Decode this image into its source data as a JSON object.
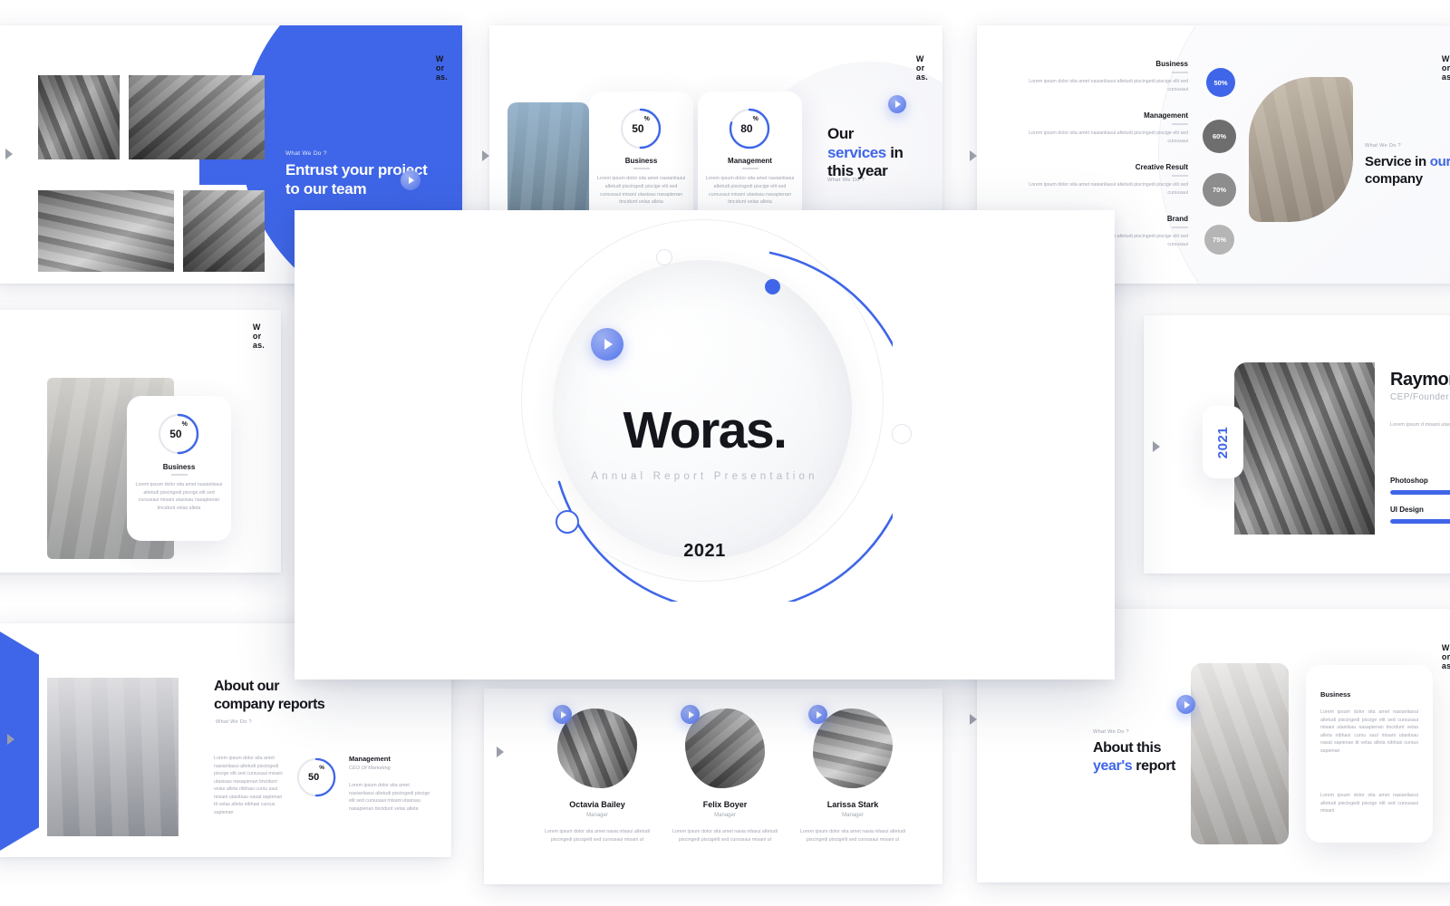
{
  "brand": {
    "logo_lines": [
      "W",
      "or",
      "as."
    ],
    "accent_color": "#3f66e8",
    "accent_color_light": "#7f97ef",
    "dark_color": "#14161c",
    "muted_color": "#a2a7b2"
  },
  "lorem": {
    "short": "Lorem ipsum dolor sita amet nasianliasui altetudi piscingedi piscige elit sed cursusaui misani utasisau nasapienan tincidunt velas alleta",
    "two_line": "Lorem ipsum dolor sita amet nasianliasui altetudi piscingedi piscige elit sed cursusaui",
    "team": "Lorem ipsum dolor sita amet nasia nilasui altetudi piscingedi piscigelit sed cursusaui misani ut",
    "long": "Lorem ipsum dolor sita amet nasianliasui altetudi piscingedi piscige elit sed cursusaui misani utasilsau nasapienan tincidunt velas alleta nibhasi cursu saul misani utasitsau nasat sapienan tit velas alleta nibhasi cursus sapienan",
    "medium": "Lorem ipsum dolor sita amet nasianliasui altetudi piscingedi piscige elit sed cursusaui misani",
    "col_left": "Lorem ipsum dolor sita amet nasianliasui altetudi piscingedi piscige elit sed cursusaui misani utasisau nasapienan tincidunt velas alleta nibhasi cursu saul misani utasitsau nasat sapienan tit velas alleta nibhasi cursus sapienan",
    "bio": "Lorem ipsum d misani utasitsau nasat sapienan utasitsau nasapi"
  },
  "slides": {
    "entrust": {
      "eyebrow": "What We Do ?",
      "title": "Entrust your project to our team",
      "nav_label": "next-slide"
    },
    "services": {
      "title_line1": "Our",
      "title_accent": "services",
      "title_line1_tail": "in",
      "title_line2": "this year",
      "eyebrow": "What We Do ?",
      "cards": [
        {
          "percent": "50",
          "symbol": "%",
          "label": "Business",
          "value": 50,
          "body": "Lorem ipsum dolor sita amet nasianliasui altetudi piscingedi piscige elit sed cursusaui misani utasisau nasapienan tincidunt velas alleta"
        },
        {
          "percent": "80",
          "symbol": "%",
          "label": "Management",
          "value": 80,
          "body": "Lorem ipsum dolor sita amet nasianliasui altetudi piscingedi piscige elit sed cursusaui misani utasisau nasapienan tincidunt velas alleta"
        }
      ]
    },
    "service_company": {
      "eyebrow": "What We Do ?",
      "title_lead": "Service in",
      "title_accent": "our",
      "title_line2": "company",
      "items": [
        {
          "label": "Business",
          "percent": "50%",
          "body": "Lorem ipsum dolor sita amet nasianliasui altetudi piscingedi piscige elit sed cursusaui",
          "color": "#3f66e8"
        },
        {
          "label": "Management",
          "percent": "60%",
          "body": "Lorem ipsum dolor sita amet nasianliasui altetudi piscingedi piscige elit sed cursusaui",
          "color": "#6e6e6e"
        },
        {
          "label": "Creative Result",
          "percent": "70%",
          "body": "Lorem ipsum dolor sita amet nasianliasui altetudi piscingedi piscige elit sed cursusaui",
          "color": "#8d8d8d"
        },
        {
          "label": "Brand",
          "percent": "75%",
          "body": "Lorem ipsum dolor sita amet nasianliasui altetudi piscingedi piscige elit sed cursusaui",
          "color": "#b5b5b5"
        }
      ]
    },
    "business_card": {
      "percent": "50",
      "symbol": "%",
      "value": 50,
      "label": "Business",
      "body": "Lorem ipsum dolor sita amet nasianliasui altetudi piscingedi piscige elit sed cursusaui misani utasisau nasapienan tincidunt velas alleta"
    },
    "profile": {
      "name": "Raymond",
      "role": "CEP/Founder",
      "badge_year": "2021",
      "bio": "Lorem ipsum d misani utasitsau nasat sapienan utasitsau nasapi",
      "skills": [
        {
          "label": "Photoshop",
          "value": 85
        },
        {
          "label": "UI Design",
          "value": 90
        }
      ]
    },
    "hero": {
      "title": "Woras.",
      "subtitle": "Annual Report Presentation",
      "year": "2021"
    },
    "about_reports": {
      "title_line1": "About our",
      "title_line2": "company reports",
      "eyebrow": "What We Do ?",
      "left_body": "Lorem ipsum dolor sita amet nasianliasui altetudi piscingedi piscige elit sed cursusaui misani utasisau nasapienan tincidunt velas alleta nibhasi cursu saul misani utasitsau nasat sapienan tit velas alleta nibhasi cursus sapienan",
      "stat_percent": "50",
      "stat_symbol": "%",
      "stat_value": 50,
      "stat_label": "Management",
      "stat_sub": "CEO Of Marketing",
      "stat_body": "Lorem ipsum dolor sita amet nasianliasui altetudi piscingedi piscige elit sed cursusaui misani utasisau nasapienan tincidunt velas alleta"
    },
    "team": {
      "members": [
        {
          "name": "Octavia Bailey",
          "role": "Manager",
          "body": "Lorem ipsum dolor sita amet nasia nilasui altetudi piscingedi piscigelit sed cursusaui misani ut"
        },
        {
          "name": "Felix Boyer",
          "role": "Manager",
          "body": "Lorem ipsum dolor sita amet nasia nilasui altetudi piscingedi piscigelit sed cursusaui misani ut"
        },
        {
          "name": "Larissa Stark",
          "role": "Manager",
          "body": "Lorem ipsum dolor sita amet nasia nilasui altetudi piscingedi piscigelit sed cursusaui misani ut"
        }
      ]
    },
    "about_year": {
      "eyebrow": "What We Do ?",
      "title_line1": "About this",
      "title_accent": "year's",
      "title_tail": "report",
      "card_heading": "Business",
      "card_body_1": "Lorem ipsum dolor sita amet nasianliaoui altetudi piscingedi piscige elit sed cursusaui misani utasilsau nasapienan tincidunt velas alleta nibhasi cursu saul misani utasitsau nasat sapienan tit velas alleta nibhasi cursus sapienan",
      "card_body_2": "Lorem ipsum dolor sita amet nasianliaoui altetudi piscingedi piscige elit sed cursusaui misani"
    }
  }
}
